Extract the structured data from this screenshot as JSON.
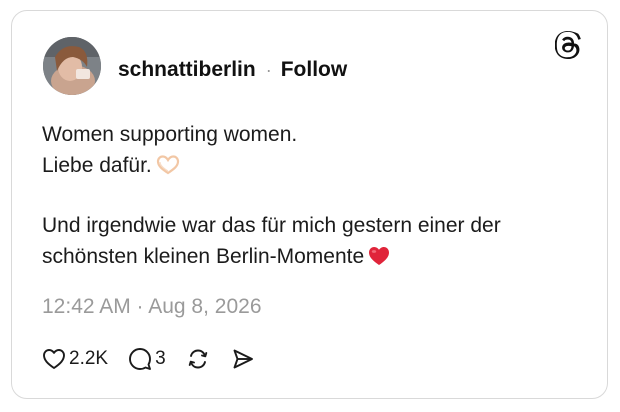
{
  "post": {
    "username": "schnattiberlin",
    "separator": "·",
    "follow_label": "Follow",
    "body_lines": [
      "Women supporting women.",
      "Liebe dafür.",
      "",
      "Und irgendwie war das für mich gestern einer der",
      "schönsten kleinen Berlin-Momente"
    ],
    "timestamp": "12:42 AM · Aug 8, 2026",
    "likes": "2.2K",
    "replies": "3"
  },
  "icons": {
    "brand": "threads-logo-icon",
    "like": "heart-icon",
    "reply": "comment-bubble-icon",
    "repost": "repost-icon",
    "share": "send-icon",
    "emoji_1": "heart-hands-emoji",
    "emoji_2": "red-heart-emoji"
  },
  "colors": {
    "text": "#1b1b1b",
    "muted": "#9a9a9a",
    "border": "#d9d9d9",
    "heart_red": "#e0243a"
  }
}
